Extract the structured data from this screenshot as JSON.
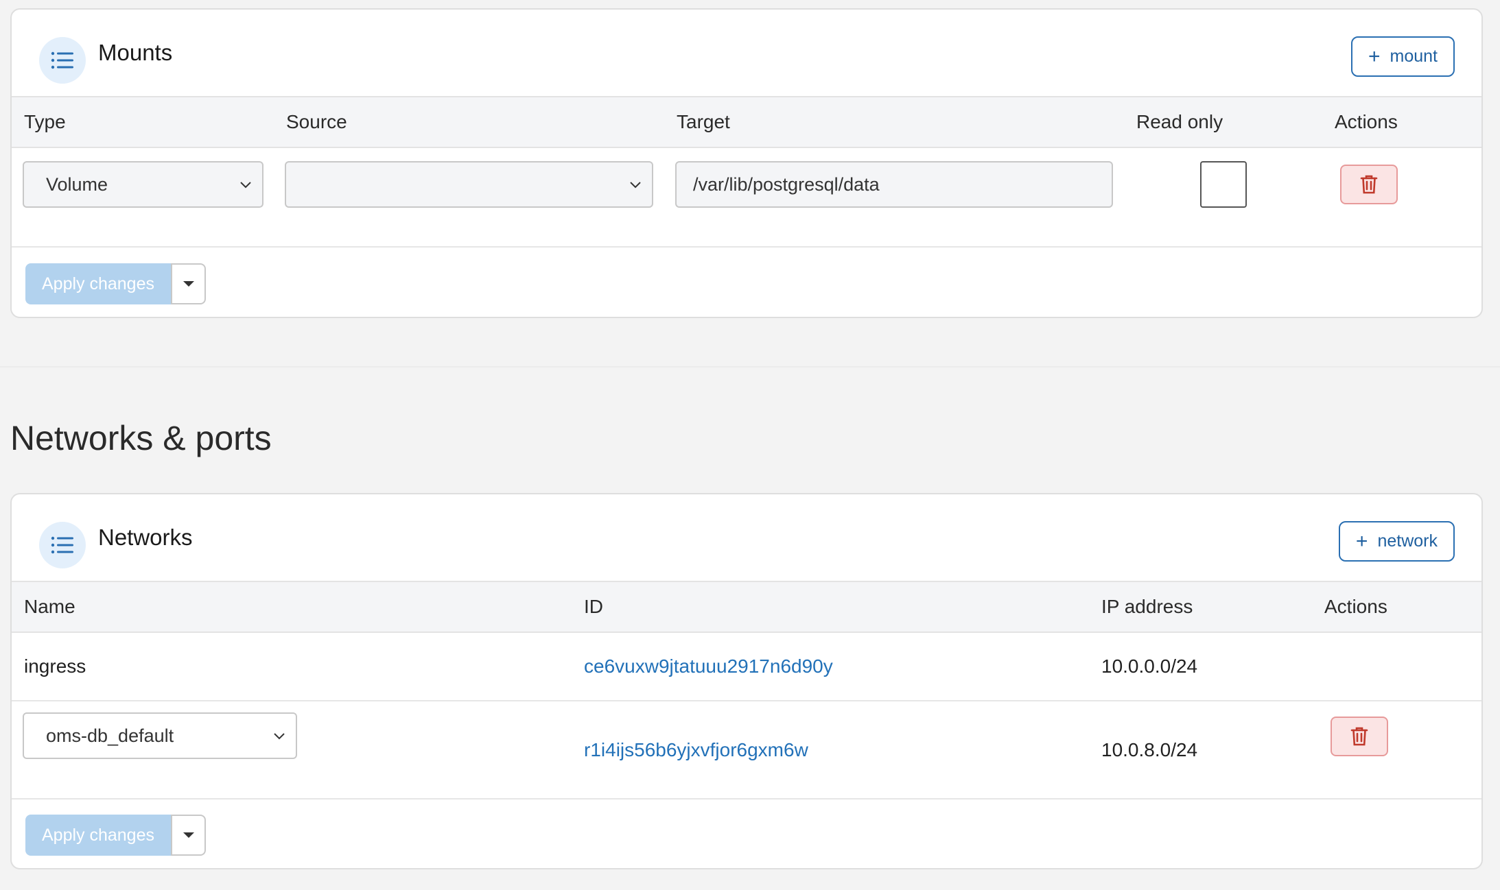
{
  "mounts": {
    "title": "Mounts",
    "add_label": "mount",
    "columns": [
      "Type",
      "Source",
      "Target",
      "Read only",
      "Actions"
    ],
    "rows": [
      {
        "type": "Volume",
        "source": "",
        "target": "/var/lib/postgresql/data",
        "read_only": false
      }
    ],
    "apply_label": "Apply changes"
  },
  "section_title": "Networks & ports",
  "networks": {
    "title": "Networks",
    "add_label": "network",
    "columns": [
      "Name",
      "ID",
      "IP address",
      "Actions"
    ],
    "rows": [
      {
        "name": "ingress",
        "id": "ce6vuxw9jtatuuu2917n6d90y",
        "ip": "10.0.0.0/24"
      },
      {
        "name": "oms-db_default",
        "id": "r1i4ijs56b6yjxvfjor6gxm6w",
        "ip": "10.0.8.0/24"
      }
    ],
    "apply_label": "Apply changes"
  },
  "colors": {
    "accent": "#2a6fb2",
    "link": "#2271b8",
    "danger": "#c0392b",
    "danger_bg": "#fbe4e4",
    "apply_disabled": "#b2d2ee"
  },
  "icons": [
    "list-icon",
    "plus-icon",
    "chevron-down-icon",
    "trash-icon",
    "caret-down-icon"
  ]
}
